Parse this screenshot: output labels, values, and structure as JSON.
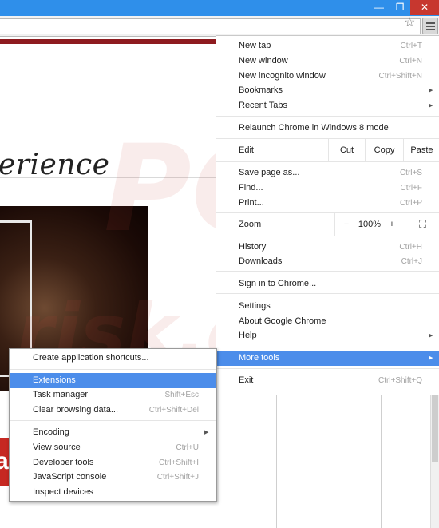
{
  "window": {
    "minimize_glyph": "—",
    "maximize_glyph": "❐",
    "close_glyph": "✕",
    "close_color": "#c7372f",
    "titlebar_color": "#2f8fea"
  },
  "toolbar": {
    "bookmark_icon": "☆",
    "menu_icon": "hamburger-icon"
  },
  "page": {
    "headline": "erience",
    "badge": "a",
    "watermark_top": "PC",
    "watermark_bottom": "risk.com"
  },
  "menu": {
    "highlight_color": "#4c8dea",
    "new_tab": {
      "label": "New tab",
      "shortcut": "Ctrl+T"
    },
    "new_window": {
      "label": "New window",
      "shortcut": "Ctrl+N"
    },
    "new_incognito": {
      "label": "New incognito window",
      "shortcut": "Ctrl+Shift+N"
    },
    "bookmarks": {
      "label": "Bookmarks"
    },
    "recent_tabs": {
      "label": "Recent Tabs"
    },
    "relaunch": {
      "label": "Relaunch Chrome in Windows 8 mode"
    },
    "edit": {
      "label": "Edit",
      "cut": "Cut",
      "copy": "Copy",
      "paste": "Paste"
    },
    "save_page": {
      "label": "Save page as...",
      "shortcut": "Ctrl+S"
    },
    "find": {
      "label": "Find...",
      "shortcut": "Ctrl+F"
    },
    "print": {
      "label": "Print...",
      "shortcut": "Ctrl+P"
    },
    "zoom": {
      "label": "Zoom",
      "minus": "−",
      "value": "100%",
      "plus": "+",
      "fullscreen": "⛶"
    },
    "history": {
      "label": "History",
      "shortcut": "Ctrl+H"
    },
    "downloads": {
      "label": "Downloads",
      "shortcut": "Ctrl+J"
    },
    "sign_in": {
      "label": "Sign in to Chrome..."
    },
    "settings": {
      "label": "Settings"
    },
    "about": {
      "label": "About Google Chrome"
    },
    "help": {
      "label": "Help"
    },
    "more_tools": {
      "label": "More tools"
    },
    "exit": {
      "label": "Exit",
      "shortcut": "Ctrl+Shift+Q"
    },
    "submenu_arrow": "▶"
  },
  "submenu": {
    "create_shortcuts": {
      "label": "Create application shortcuts..."
    },
    "extensions": {
      "label": "Extensions"
    },
    "task_manager": {
      "label": "Task manager",
      "shortcut": "Shift+Esc"
    },
    "clear_data": {
      "label": "Clear browsing data...",
      "shortcut": "Ctrl+Shift+Del"
    },
    "encoding": {
      "label": "Encoding"
    },
    "view_source": {
      "label": "View source",
      "shortcut": "Ctrl+U"
    },
    "dev_tools": {
      "label": "Developer tools",
      "shortcut": "Ctrl+Shift+I"
    },
    "js_console": {
      "label": "JavaScript console",
      "shortcut": "Ctrl+Shift+J"
    },
    "inspect": {
      "label": "Inspect devices"
    }
  }
}
